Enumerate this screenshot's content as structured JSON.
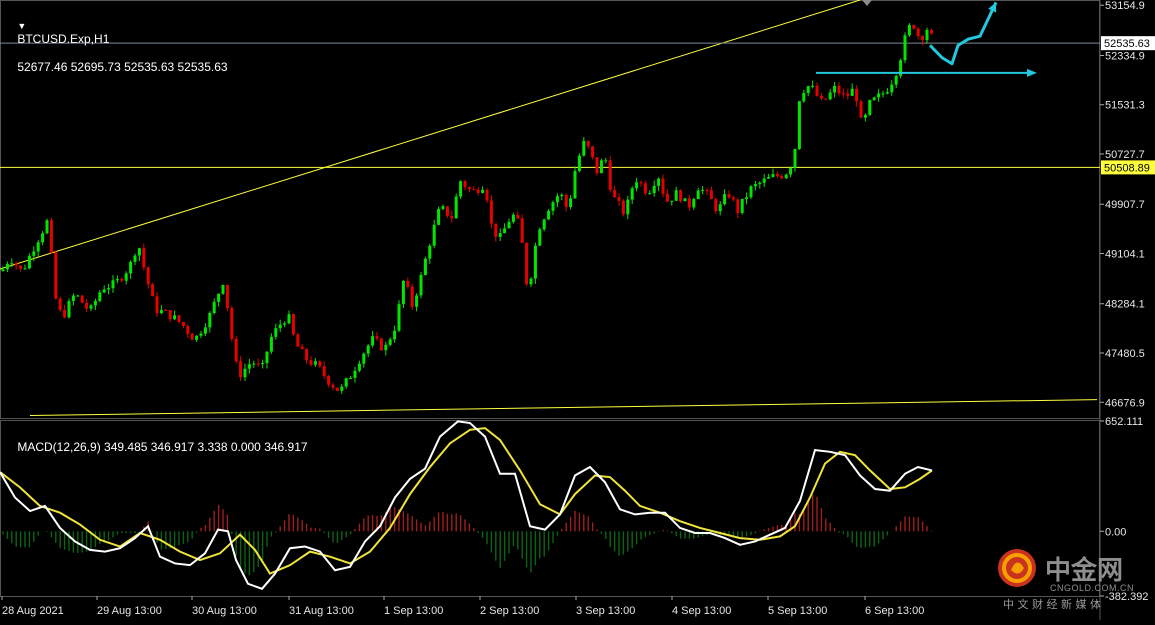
{
  "header": {
    "symbol": "BTCUSD.Exp,H1",
    "ohlc": "52677.46 52695.73 52535.63 52535.63",
    "macd_label": "MACD(12,26,9) 349.485 346.917 3.338 0.000 346.917"
  },
  "watermark": {
    "brand": "中金网",
    "url": "CNGOLD.COM.CN",
    "tagline": "中 文 财 经 新 媒 体"
  },
  "colors": {
    "bull": "#00e600",
    "bear": "#e60000",
    "bg": "#000000",
    "grid": "#3a3a3a",
    "trend": "#ffff3c",
    "arrow": "#22c8dc",
    "macd_main": "#ffffff",
    "macd_signal": "#f0e43a",
    "hist_pos": "#a01e1e",
    "hist_neg": "#0a6414",
    "current_price_line": "#7b8a99"
  },
  "chart_data": [
    {
      "type": "candlestick",
      "title": "BTCUSD.Exp,H1",
      "price_axis": {
        "range": [
          46420,
          53240
        ],
        "ticks": [
          "53154.9",
          "52334.9",
          "51531.3",
          "50727.7",
          "49907.7",
          "49104.1",
          "48284.1",
          "47480.5",
          "46676.9"
        ]
      },
      "time_axis": {
        "labels": [
          "28 Aug 2021",
          "29 Aug 13:00",
          "30 Aug 13:00",
          "31 Aug 13:00",
          "1 Sep 13:00",
          "2 Sep 13:00",
          "3 Sep 13:00",
          "4 Sep 13:00",
          "5 Sep 13:00",
          "6 Sep 13:00"
        ]
      },
      "current_price": "52535.63",
      "horizontal_level": "50508.89",
      "path_points": [
        [
          0,
          48760
        ],
        [
          10,
          49050
        ],
        [
          22,
          48800
        ],
        [
          35,
          49250
        ],
        [
          48,
          49650
        ],
        [
          55,
          48400
        ],
        [
          62,
          48050
        ],
        [
          75,
          48450
        ],
        [
          90,
          48150
        ],
        [
          102,
          48550
        ],
        [
          115,
          48600
        ],
        [
          130,
          48900
        ],
        [
          138,
          49300
        ],
        [
          145,
          48800
        ],
        [
          155,
          48200
        ],
        [
          170,
          48100
        ],
        [
          182,
          47950
        ],
        [
          195,
          47700
        ],
        [
          210,
          48100
        ],
        [
          224,
          48700
        ],
        [
          230,
          47900
        ],
        [
          238,
          47100
        ],
        [
          252,
          47350
        ],
        [
          262,
          47200
        ],
        [
          270,
          47700
        ],
        [
          280,
          47950
        ],
        [
          288,
          48100
        ],
        [
          295,
          47650
        ],
        [
          305,
          47400
        ],
        [
          318,
          47250
        ],
        [
          330,
          47000
        ],
        [
          340,
          46850
        ],
        [
          350,
          47100
        ],
        [
          360,
          47400
        ],
        [
          372,
          47700
        ],
        [
          385,
          47550
        ],
        [
          396,
          47950
        ],
        [
          404,
          48700
        ],
        [
          412,
          48250
        ],
        [
          420,
          48650
        ],
        [
          430,
          49300
        ],
        [
          440,
          49850
        ],
        [
          452,
          49700
        ],
        [
          460,
          50300
        ],
        [
          472,
          50100
        ],
        [
          485,
          50250
        ],
        [
          492,
          49500
        ],
        [
          500,
          49350
        ],
        [
          512,
          49750
        ],
        [
          520,
          49550
        ],
        [
          528,
          48450
        ],
        [
          538,
          49500
        ],
        [
          548,
          49850
        ],
        [
          560,
          50100
        ],
        [
          568,
          49800
        ],
        [
          576,
          50550
        ],
        [
          585,
          50950
        ],
        [
          597,
          50450
        ],
        [
          605,
          50700
        ],
        [
          612,
          50050
        ],
        [
          625,
          49750
        ],
        [
          635,
          50350
        ],
        [
          648,
          50100
        ],
        [
          658,
          50400
        ],
        [
          666,
          49950
        ],
        [
          678,
          50100
        ],
        [
          688,
          49850
        ],
        [
          698,
          50200
        ],
        [
          708,
          50050
        ],
        [
          718,
          49800
        ],
        [
          728,
          50100
        ],
        [
          738,
          49800
        ],
        [
          750,
          50150
        ],
        [
          760,
          50250
        ],
        [
          772,
          50350
        ],
        [
          785,
          50400
        ],
        [
          794,
          50650
        ],
        [
          800,
          51750
        ],
        [
          810,
          51850
        ],
        [
          822,
          51550
        ],
        [
          835,
          51800
        ],
        [
          845,
          51650
        ],
        [
          855,
          51800
        ],
        [
          862,
          51150
        ],
        [
          870,
          51550
        ],
        [
          882,
          51700
        ],
        [
          890,
          51850
        ],
        [
          898,
          52150
        ],
        [
          905,
          52600
        ],
        [
          912,
          52900
        ],
        [
          920,
          52600
        ],
        [
          928,
          52800
        ],
        [
          934,
          52500
        ]
      ],
      "forecast_path": [
        [
          930,
          52500
        ],
        [
          942,
          52300
        ],
        [
          952,
          52200
        ],
        [
          958,
          52500
        ],
        [
          968,
          52600
        ],
        [
          980,
          52650
        ],
        [
          996,
          53200
        ]
      ],
      "resistance_ray": {
        "from": [
          816,
          52050
        ],
        "to": [
          1037,
          52050
        ]
      },
      "trendline_upper": [
        [
          0,
          48850
        ],
        [
          860,
          53240
        ]
      ],
      "trendline_lower": [
        [
          30,
          46460
        ],
        [
          1097,
          46720
        ]
      ]
    },
    {
      "type": "macd",
      "params": "12,26,9",
      "y_axis": {
        "range": [
          -382.392,
          652.111
        ],
        "ticks": [
          "652.111",
          "0.00",
          "-382.392"
        ]
      },
      "macd_main": [
        [
          0,
          350
        ],
        [
          15,
          200
        ],
        [
          30,
          120
        ],
        [
          45,
          150
        ],
        [
          60,
          20
        ],
        [
          75,
          -60
        ],
        [
          90,
          -110
        ],
        [
          105,
          -120
        ],
        [
          120,
          -100
        ],
        [
          135,
          -40
        ],
        [
          148,
          30
        ],
        [
          160,
          -150
        ],
        [
          175,
          -190
        ],
        [
          190,
          -200
        ],
        [
          205,
          -130
        ],
        [
          218,
          10
        ],
        [
          228,
          0
        ],
        [
          236,
          -170
        ],
        [
          248,
          -310
        ],
        [
          262,
          -340
        ],
        [
          275,
          -250
        ],
        [
          290,
          -100
        ],
        [
          305,
          -90
        ],
        [
          320,
          -120
        ],
        [
          335,
          -230
        ],
        [
          350,
          -210
        ],
        [
          365,
          -60
        ],
        [
          380,
          30
        ],
        [
          395,
          200
        ],
        [
          410,
          310
        ],
        [
          425,
          370
        ],
        [
          440,
          560
        ],
        [
          458,
          650
        ],
        [
          470,
          640
        ],
        [
          485,
          560
        ],
        [
          500,
          340
        ],
        [
          515,
          340
        ],
        [
          530,
          30
        ],
        [
          545,
          10
        ],
        [
          560,
          100
        ],
        [
          575,
          330
        ],
        [
          590,
          380
        ],
        [
          605,
          290
        ],
        [
          620,
          130
        ],
        [
          635,
          100
        ],
        [
          650,
          110
        ],
        [
          665,
          110
        ],
        [
          680,
          20
        ],
        [
          695,
          -10
        ],
        [
          710,
          -10
        ],
        [
          725,
          -40
        ],
        [
          740,
          -80
        ],
        [
          755,
          -60
        ],
        [
          770,
          -20
        ],
        [
          785,
          20
        ],
        [
          800,
          180
        ],
        [
          815,
          480
        ],
        [
          830,
          470
        ],
        [
          845,
          450
        ],
        [
          860,
          330
        ],
        [
          875,
          250
        ],
        [
          890,
          240
        ],
        [
          905,
          340
        ],
        [
          918,
          380
        ],
        [
          932,
          360
        ]
      ],
      "macd_signal": [
        [
          0,
          350
        ],
        [
          20,
          260
        ],
        [
          40,
          150
        ],
        [
          60,
          110
        ],
        [
          80,
          40
        ],
        [
          100,
          -50
        ],
        [
          120,
          -90
        ],
        [
          140,
          -10
        ],
        [
          160,
          -50
        ],
        [
          180,
          -120
        ],
        [
          200,
          -170
        ],
        [
          220,
          -130
        ],
        [
          240,
          -20
        ],
        [
          255,
          -110
        ],
        [
          270,
          -250
        ],
        [
          290,
          -200
        ],
        [
          310,
          -120
        ],
        [
          330,
          -150
        ],
        [
          350,
          -190
        ],
        [
          370,
          -120
        ],
        [
          390,
          20
        ],
        [
          410,
          220
        ],
        [
          430,
          380
        ],
        [
          450,
          520
        ],
        [
          470,
          600
        ],
        [
          485,
          610
        ],
        [
          500,
          540
        ],
        [
          520,
          360
        ],
        [
          540,
          160
        ],
        [
          560,
          100
        ],
        [
          575,
          220
        ],
        [
          595,
          330
        ],
        [
          610,
          320
        ],
        [
          625,
          240
        ],
        [
          640,
          150
        ],
        [
          660,
          110
        ],
        [
          680,
          60
        ],
        [
          700,
          20
        ],
        [
          720,
          -10
        ],
        [
          740,
          -40
        ],
        [
          760,
          -50
        ],
        [
          780,
          -30
        ],
        [
          795,
          30
        ],
        [
          810,
          200
        ],
        [
          825,
          400
        ],
        [
          840,
          470
        ],
        [
          855,
          450
        ],
        [
          870,
          360
        ],
        [
          890,
          250
        ],
        [
          905,
          260
        ],
        [
          920,
          310
        ],
        [
          932,
          360
        ]
      ]
    }
  ]
}
